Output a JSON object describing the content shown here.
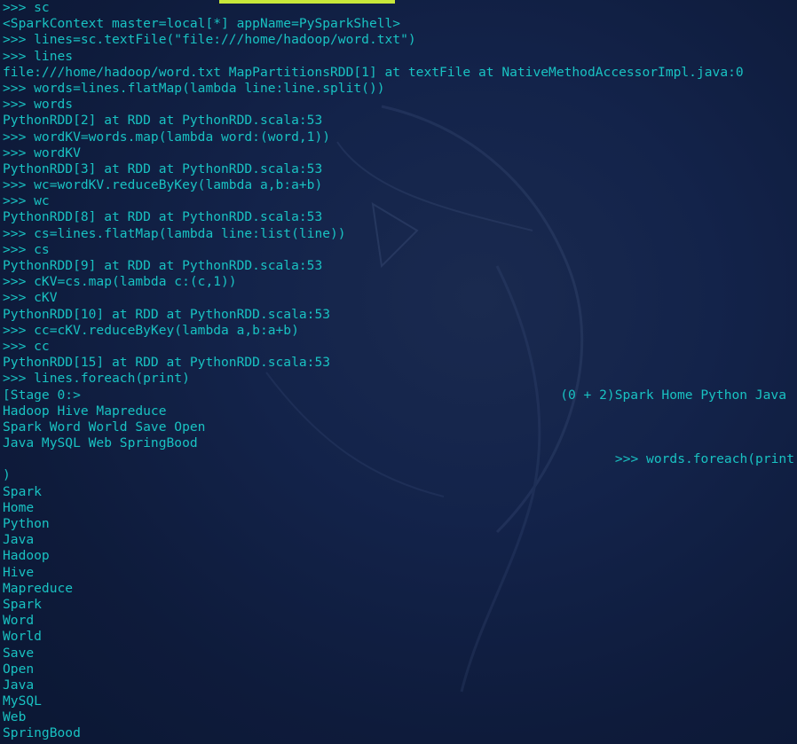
{
  "terminal": {
    "lines": [
      ">>> sc",
      "<SparkContext master=local[*] appName=PySparkShell>",
      ">>> lines=sc.textFile(\"file:///home/hadoop/word.txt\")",
      ">>> lines",
      "file:///home/hadoop/word.txt MapPartitionsRDD[1] at textFile at NativeMethodAccessorImpl.java:0",
      ">>> words=lines.flatMap(lambda line:line.split())",
      ">>> words",
      "PythonRDD[2] at RDD at PythonRDD.scala:53",
      ">>> wordKV=words.map(lambda word:(word,1))",
      ">>> wordKV",
      "PythonRDD[3] at RDD at PythonRDD.scala:53",
      ">>> wc=wordKV.reduceByKey(lambda a,b:a+b)",
      ">>> wc",
      "PythonRDD[8] at RDD at PythonRDD.scala:53",
      ">>> cs=lines.flatMap(lambda line:list(line))",
      ">>> cs",
      "PythonRDD[9] at RDD at PythonRDD.scala:53",
      ">>> cKV=cs.map(lambda c:(c,1))",
      ">>> cKV",
      "PythonRDD[10] at RDD at PythonRDD.scala:53",
      ">>> cc=cKV.reduceByKey(lambda a,b:a+b)",
      ">>> cc",
      "PythonRDD[15] at RDD at PythonRDD.scala:53",
      ">>> lines.foreach(print)"
    ],
    "stage_left": "[Stage 0:>",
    "stage_right": "(0 + 2)Spark Home Python Java",
    "lines_after_stage": [
      "Hadoop Hive Mapreduce",
      "Spark Word World Save Open",
      "Java MySQL Web SpringBood"
    ],
    "right_aligned": ">>> words.foreach(print",
    "lines_end": [
      ")",
      "Spark",
      "Home",
      "Python",
      "Java",
      "Hadoop",
      "Hive",
      "Mapreduce",
      "Spark",
      "Word",
      "World",
      "Save",
      "Open",
      "Java",
      "MySQL",
      "Web",
      "SpringBood"
    ]
  },
  "colors": {
    "text": "#19c2c2",
    "background": "#0f1d3c",
    "marker": "#c8e83a"
  }
}
